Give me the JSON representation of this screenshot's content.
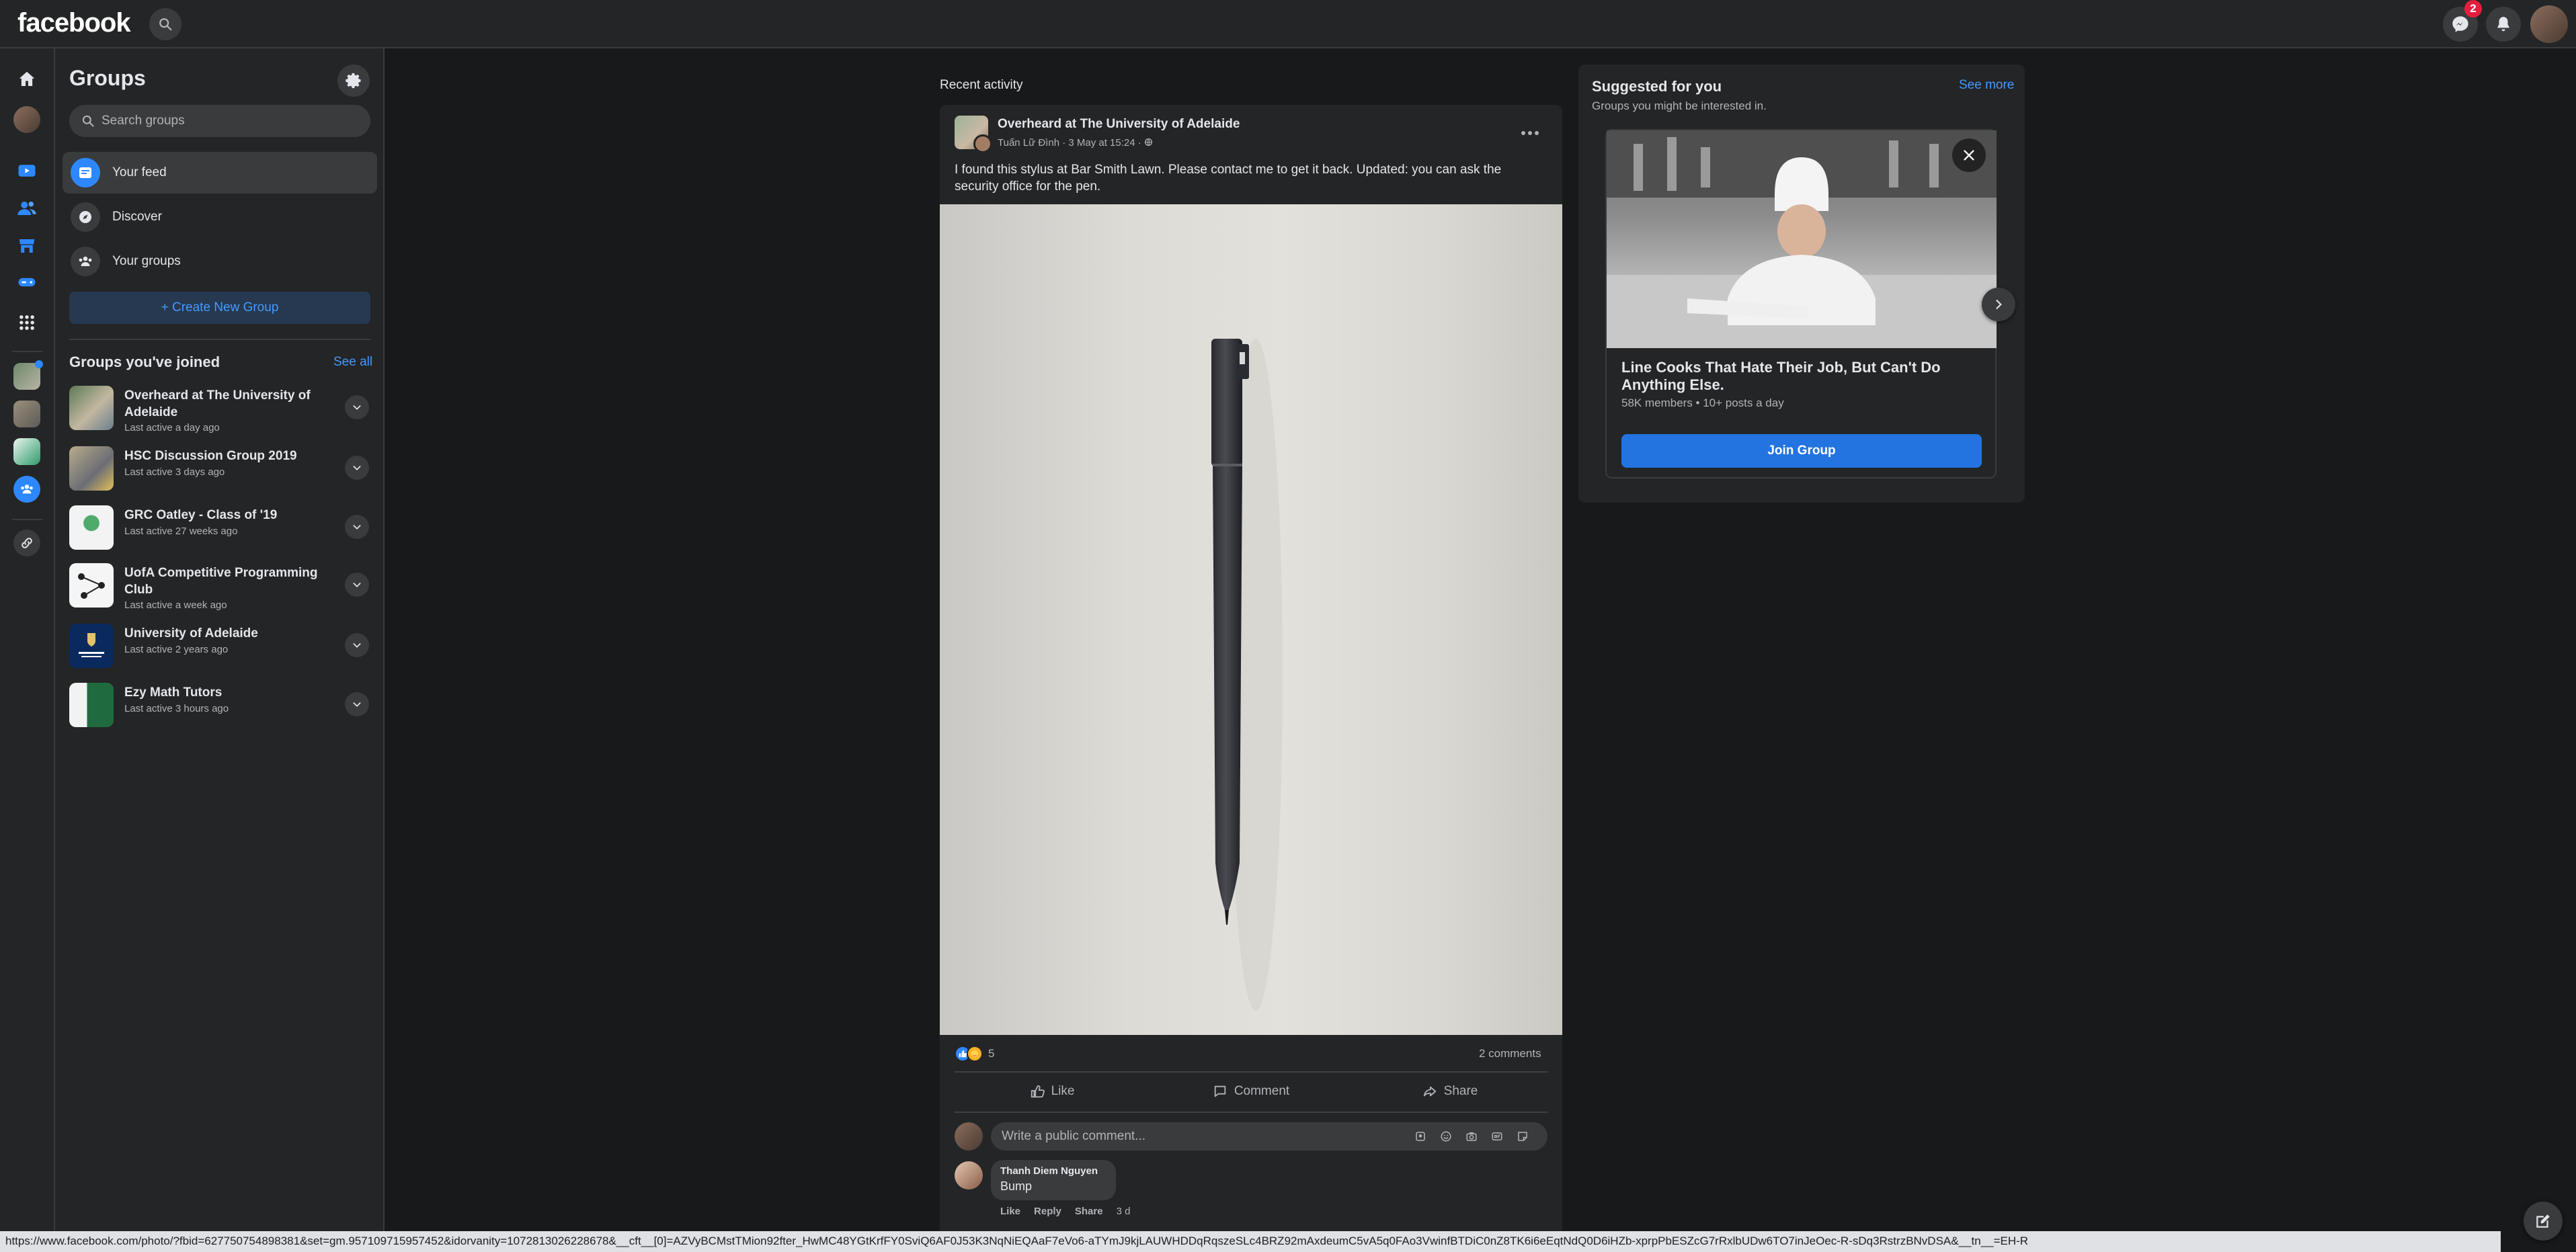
{
  "topbar": {
    "logo": "facebook",
    "messenger_badge": "2",
    "icons": [
      "search-icon",
      "messenger-icon",
      "bell-icon",
      "account-avatar"
    ]
  },
  "rail": {
    "icons": [
      "home-icon",
      "profile-avatar",
      "watch-icon",
      "friends-icon",
      "marketplace-icon",
      "gaming-icon",
      "apps-grid-icon",
      "group-shortcut",
      "group-shortcut",
      "group-shortcut",
      "groups-icon",
      "link-icon"
    ]
  },
  "sidebar": {
    "title": "Groups",
    "search_placeholder": "Search groups",
    "nav": [
      {
        "label": "Your feed"
      },
      {
        "label": "Discover"
      },
      {
        "label": "Your groups"
      }
    ],
    "create_label": "+ Create New Group",
    "joined_title": "Groups you've joined",
    "see_all": "See all",
    "groups": [
      {
        "name": "Overheard at The University of Adelaide",
        "meta": "Last active a day ago"
      },
      {
        "name": "HSC Discussion Group 2019",
        "meta": "Last active 3 days ago"
      },
      {
        "name": "GRC Oatley - Class of '19",
        "meta": "Last active 27 weeks ago"
      },
      {
        "name": "UofA Competitive Programming Club",
        "meta": "Last active a week ago"
      },
      {
        "name": "University of Adelaide",
        "meta": "Last active 2 years ago"
      },
      {
        "name": "Ezy Math Tutors",
        "meta": "Last active 3 hours ago"
      }
    ]
  },
  "feed": {
    "recent_label": "Recent activity",
    "post": {
      "group": "Overheard at The University of Adelaide",
      "author_line": "Tuấn Lữ Đình · 3 May at 15:24 · ",
      "text": "I found this stylus at Bar Smith Lawn. Please contact me to get it back. Updated: you can ask the security office for the pen.",
      "reaction_count": "5",
      "comment_count": "2 comments",
      "actions": {
        "like": "Like",
        "comment": "Comment",
        "share": "Share"
      },
      "comment_placeholder": "Write a public comment...",
      "comment": {
        "author": "Thanh Diem Nguyen",
        "text": "Bump",
        "like": "Like",
        "reply": "Reply",
        "share": "Share",
        "time": "3 d"
      }
    }
  },
  "suggested": {
    "title": "Suggested for you",
    "subtitle": "Groups you might be interested in.",
    "see_more": "See more",
    "group_name": "Line Cooks That Hate Their Job, But Can't Do Anything Else.",
    "group_meta": "58K members • 10+ posts a day",
    "join_label": "Join Group"
  },
  "statusbar": {
    "url": "https://www.facebook.com/photo/?fbid=627750754898381&set=gm.957109715957452&idorvanity=1072813026228678&__cft__[0]=AZVyBCMstTMion92fter_HwMC48YGtKrfFY0SviQ6AF0J53K3NqNiEQAaF7eVo6-aTYmJ9kjLAUWHDDqRqszeSLc4BRZ92mAxdeumC5vA5q0FAo3VwinfBTDiC0nZ8TK6i6eEqtNdQ0D6iHZb-xprpPbESZcG7rRxlbUDw6TO7inJeOec-R-sDq3RstrzBNvDSA&__tn__=EH-R"
  },
  "colors": {
    "bg": "#18191a",
    "surface": "#242526",
    "accent": "#2374e1",
    "link": "#4599ff",
    "badge": "#e41e3f"
  }
}
